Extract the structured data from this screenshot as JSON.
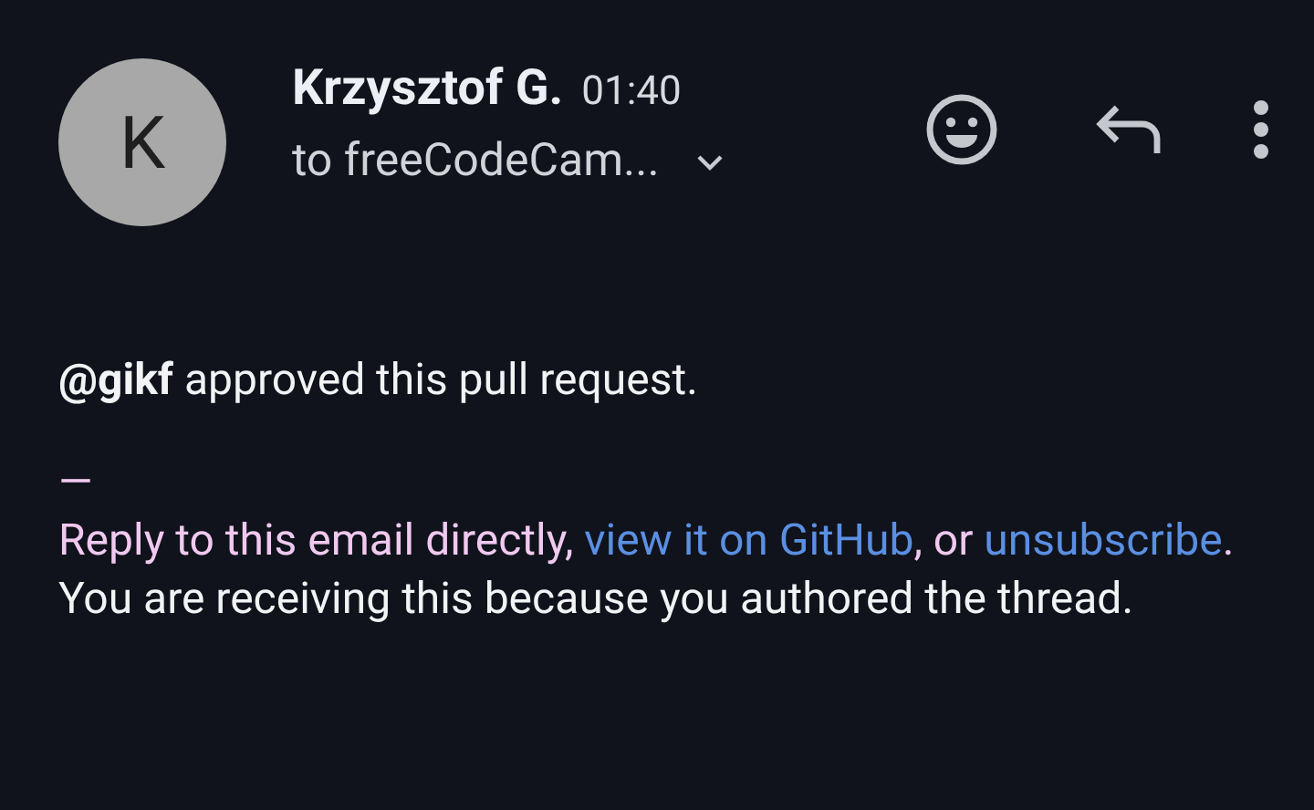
{
  "header": {
    "avatar_letter": "K",
    "sender": "Krzysztof G.",
    "time": "01:40",
    "recipient": "to freeCodeCam..."
  },
  "body": {
    "intro": "**@gikf** approved this pull request.",
    "separator": "—",
    "footer_parts": [
      {
        "kind": "text",
        "text": "Reply to this email directly, "
      },
      {
        "kind": "link",
        "text": "view it on GitHub"
      },
      {
        "kind": "text",
        "text": ", or "
      },
      {
        "kind": "link",
        "text": "unsubscribe"
      },
      {
        "kind": "text",
        "text": "."
      }
    ],
    "reason": "You are receiving this because you authored the thread."
  }
}
